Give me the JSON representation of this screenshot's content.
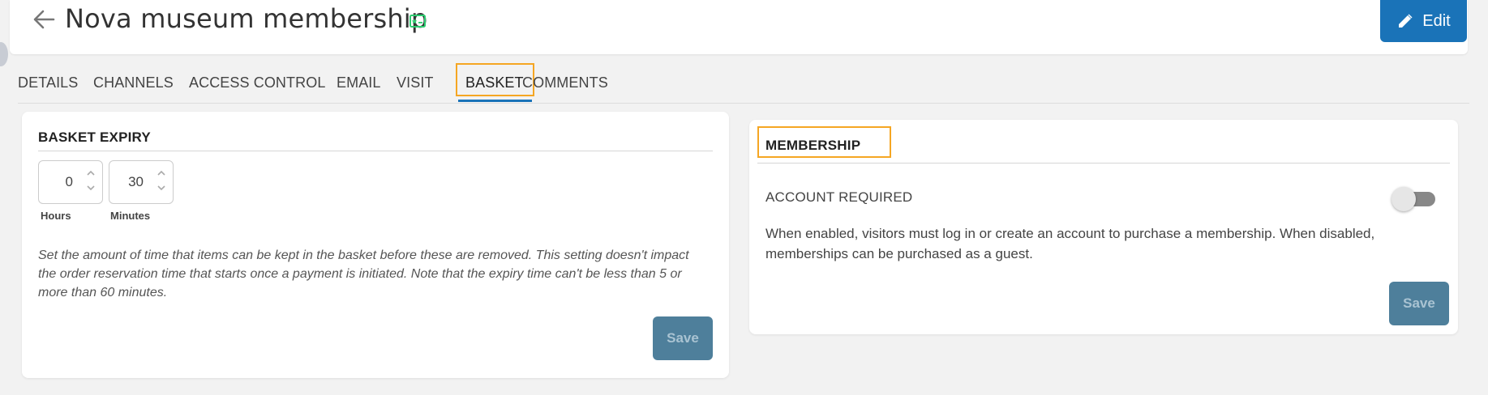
{
  "header": {
    "title": "Nova museum membership",
    "edit_label": "Edit"
  },
  "tabs": [
    {
      "label": "DETAILS"
    },
    {
      "label": "CHANNELS"
    },
    {
      "label": "ACCESS CONTROL"
    },
    {
      "label": "EMAIL"
    },
    {
      "label": "VISIT"
    },
    {
      "label": "BASKET",
      "active": true
    },
    {
      "label": "COMMENTS"
    }
  ],
  "basket_expiry": {
    "title": "BASKET EXPIRY",
    "hours_value": "0",
    "hours_label": "Hours",
    "minutes_value": "30",
    "minutes_label": "Minutes",
    "help_line1": "Set the amount of time that items can be kept in the basket before these are removed. This setting doesn't impact",
    "help_line2": "the order reservation time that starts once a payment is initiated. Note that the expiry time can't be less than 5 or",
    "help_line3": "more than 60 minutes.",
    "save_label": "Save"
  },
  "membership": {
    "title": "MEMBERSHIP",
    "account_required_label": "ACCOUNT REQUIRED",
    "account_required_enabled": false,
    "description_line1": "When enabled, visitors must log in or create an account to purchase a membership. When disabled,",
    "description_line2": "memberships can be purchased as a guest.",
    "save_label": "Save"
  },
  "colors": {
    "accent": "#1a73b8",
    "highlight": "#f5a623",
    "save_button": "#4e7f9b"
  }
}
